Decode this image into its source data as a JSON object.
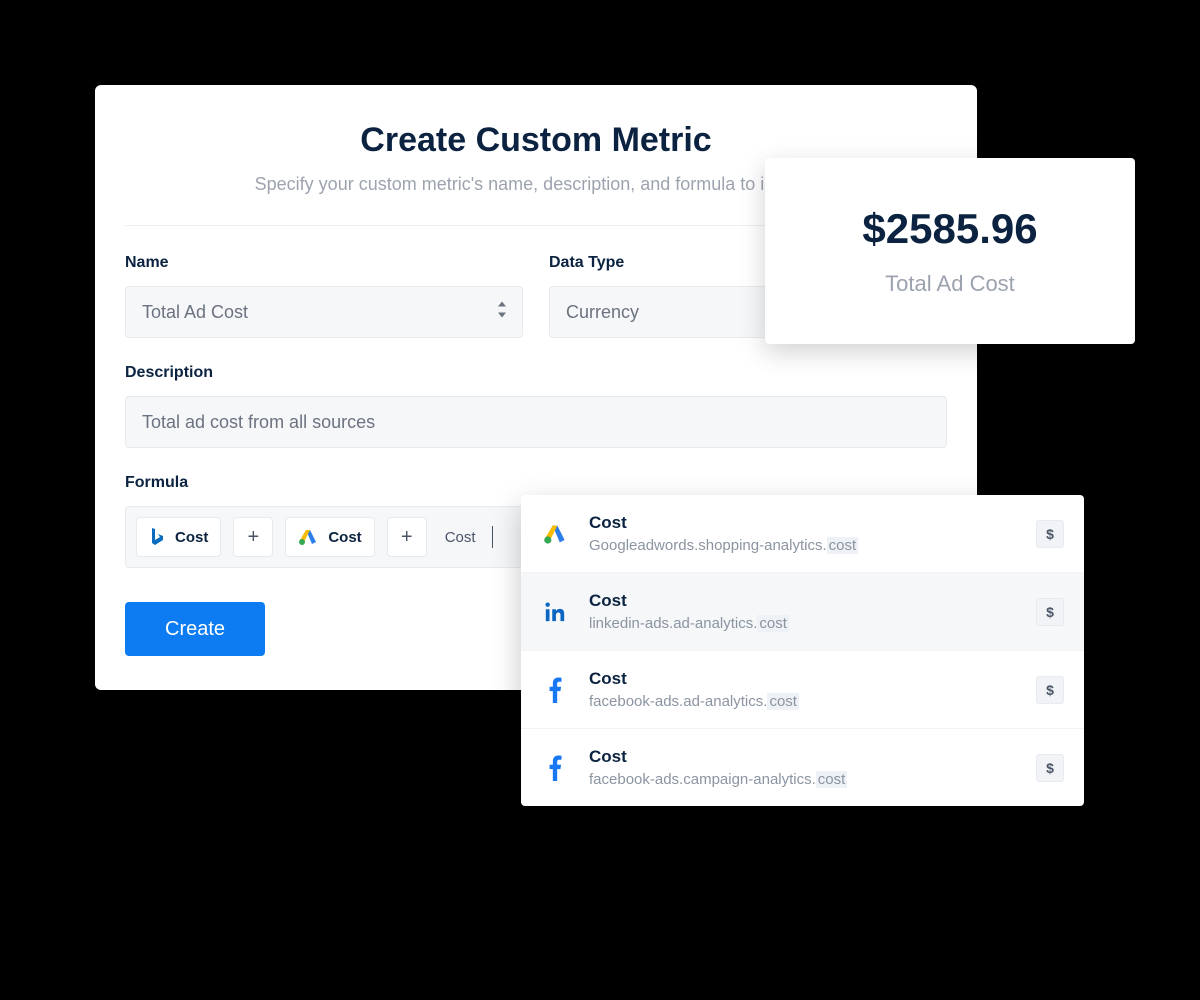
{
  "modal": {
    "title": "Create Custom Metric",
    "subtitle": "Specify your custom metric's name, description, and formula to include",
    "name_label": "Name",
    "name_value": "Total Ad Cost",
    "datatype_label": "Data Type",
    "datatype_value": "Currency",
    "description_label": "Description",
    "description_value": "Total ad cost from all sources",
    "formula_label": "Formula",
    "formula_tokens": {
      "t0": "Cost",
      "op0": "+",
      "t1": "Cost",
      "op1": "+",
      "typed": "Cost"
    },
    "create_label": "Create"
  },
  "result": {
    "value": "$2585.96",
    "label": "Total Ad Cost"
  },
  "dropdown": {
    "badge": "$",
    "items": [
      {
        "title": "Cost",
        "path_pre": "Googleadwords.shopping-analytics.",
        "path_hl": "cost",
        "icon": "google-ads"
      },
      {
        "title": "Cost",
        "path_pre": "linkedin-ads.ad-analytics.",
        "path_hl": "cost",
        "icon": "linkedin",
        "selected": true
      },
      {
        "title": "Cost",
        "path_pre": "facebook-ads.ad-analytics.",
        "path_hl": "cost",
        "icon": "facebook"
      },
      {
        "title": "Cost",
        "path_pre": "facebook-ads.campaign-analytics.",
        "path_hl": "cost",
        "icon": "facebook"
      }
    ]
  }
}
